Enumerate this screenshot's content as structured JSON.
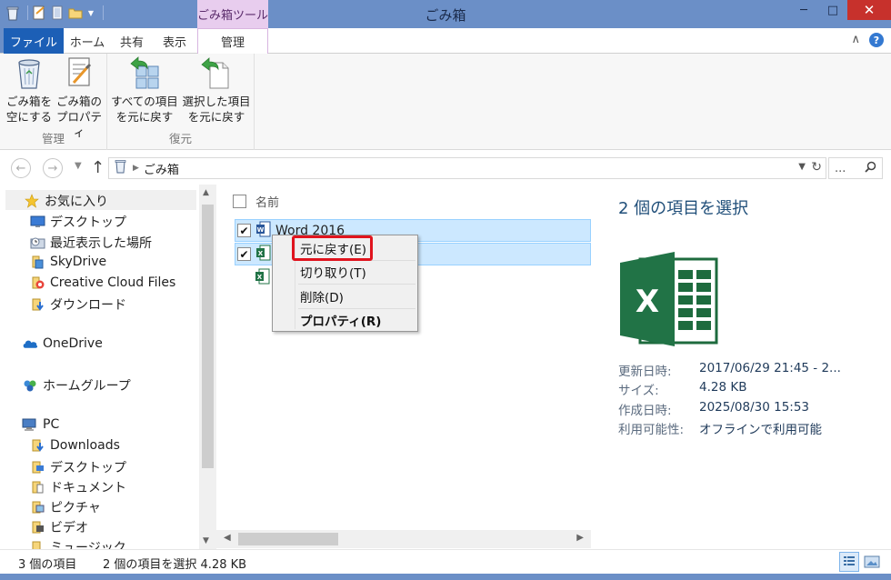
{
  "window": {
    "title": "ごみ箱",
    "context_tab_title": "ごみ箱ツール",
    "minimize": "─",
    "maximize": "□",
    "close": "✕"
  },
  "ribbon": {
    "tabs": [
      {
        "label": "ファイル"
      },
      {
        "label": "ホーム"
      },
      {
        "label": "共有"
      },
      {
        "label": "表示"
      },
      {
        "label": "管理"
      }
    ],
    "groups": [
      {
        "label": "管理",
        "buttons": [
          {
            "line1": "ごみ箱を",
            "line2": "空にする",
            "icon": "recycle-bin-icon"
          },
          {
            "line1": "ごみ箱の",
            "line2": "プロパティ",
            "icon": "properties-icon"
          }
        ]
      },
      {
        "label": "復元",
        "buttons": [
          {
            "line1": "すべての項目",
            "line2": "を元に戻す",
            "icon": "restore-all-icon"
          },
          {
            "line1": "選択した項目",
            "line2": "を元に戻す",
            "icon": "restore-selected-icon"
          }
        ]
      }
    ],
    "expand_chevron": "∧",
    "help": "?"
  },
  "address": {
    "path": "ごみ箱",
    "search_placeholder": "..."
  },
  "nav_pane": {
    "favorites_header": "お気に入り",
    "favorites": [
      {
        "label": "デスクトップ",
        "icon": "desktop-icon"
      },
      {
        "label": "最近表示した場所",
        "icon": "recent-places-icon"
      },
      {
        "label": "SkyDrive",
        "icon": "skydrive-icon"
      },
      {
        "label": "Creative Cloud Files",
        "icon": "creative-cloud-icon"
      },
      {
        "label": "ダウンロード",
        "icon": "downloads-icon"
      }
    ],
    "onedrive": "OneDrive",
    "homegroup": "ホームグループ",
    "pc": "PC",
    "pc_items": [
      {
        "label": "Downloads",
        "icon": "folder-icon"
      },
      {
        "label": "デスクトップ",
        "icon": "folder-icon"
      },
      {
        "label": "ドキュメント",
        "icon": "folder-icon"
      },
      {
        "label": "ピクチャ",
        "icon": "folder-icon"
      },
      {
        "label": "ビデオ",
        "icon": "folder-icon"
      },
      {
        "label": "ミュージック",
        "icon": "folder-icon"
      }
    ]
  },
  "file_list": {
    "column_name": "名前",
    "files": [
      {
        "name": "Word 2016",
        "checked": true,
        "icon": "word-file-icon"
      },
      {
        "name": "",
        "checked": true,
        "icon": "excel-file-icon"
      }
    ]
  },
  "context_menu": {
    "items": [
      {
        "label": "元に戻す(E)"
      },
      {
        "label": "切り取り(T)"
      },
      {
        "label": "削除(D)"
      },
      {
        "label": "プロパティ(R)"
      }
    ]
  },
  "preview": {
    "title": "2 個の項目を選択",
    "details": [
      {
        "key": "更新日時:",
        "value": "2017/06/29 21:45 - 2..."
      },
      {
        "key": "サイズ:",
        "value": "4.28 KB"
      },
      {
        "key": "作成日時:",
        "value": "2025/08/30 15:53"
      },
      {
        "key": "利用可能性:",
        "value": "オフラインで利用可能"
      }
    ]
  },
  "status": {
    "item_count": "3 個の項目",
    "selection": "2 個の項目を選択  4.28 KB"
  },
  "colors": {
    "titlebar": "#6b8fc7",
    "file_tab": "#1c5fb6",
    "context_tab": "#e8cdee",
    "selection": "#cce8ff",
    "highlight_box": "#e0141e",
    "excel_green": "#217346"
  }
}
